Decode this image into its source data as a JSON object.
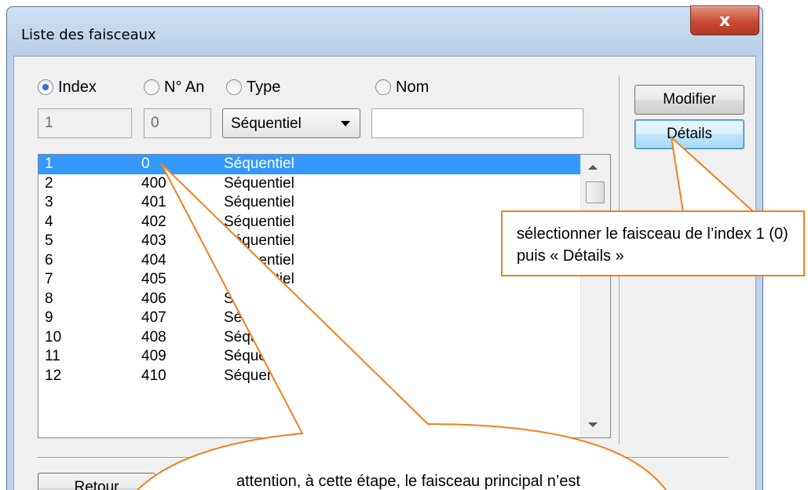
{
  "window": {
    "title": "Liste des faisceaux",
    "close_label": "x"
  },
  "search": {
    "radios": [
      {
        "label": "Index",
        "selected": true
      },
      {
        "label": "N° An",
        "selected": false
      },
      {
        "label": "Type",
        "selected": false
      },
      {
        "label": "Nom",
        "selected": false
      }
    ],
    "index_value": "1",
    "nan_value": "0",
    "type_value": "Séquentiel",
    "name_value": ""
  },
  "list": {
    "rows": [
      {
        "index": "1",
        "nan": "0",
        "type": "Séquentiel",
        "selected": true
      },
      {
        "index": "2",
        "nan": "400",
        "type": "Séquentiel"
      },
      {
        "index": "3",
        "nan": "401",
        "type": "Séquentiel"
      },
      {
        "index": "4",
        "nan": "402",
        "type": "Séquentiel"
      },
      {
        "index": "5",
        "nan": "403",
        "type": "Séquentiel"
      },
      {
        "index": "6",
        "nan": "404",
        "type": "Séquentiel"
      },
      {
        "index": "7",
        "nan": "405",
        "type": "Séquentiel"
      },
      {
        "index": "8",
        "nan": "406",
        "type": "Séquentiel"
      },
      {
        "index": "9",
        "nan": "407",
        "type": "Séquentiel"
      },
      {
        "index": "10",
        "nan": "408",
        "type": "Séquentiel"
      },
      {
        "index": "11",
        "nan": "409",
        "type": "Séquentiel"
      },
      {
        "index": "12",
        "nan": "410",
        "type": "Séquentiel"
      }
    ]
  },
  "buttons": {
    "modifier": "Modifier",
    "details": "Détails",
    "retour": "Retour"
  },
  "annotations": {
    "callout_details": "sélectionner le faisceau de l’index 1 (0) puis « Détails »",
    "callout_bottom": "attention, à cette étape, le faisceau principal n’est"
  },
  "colors": {
    "selection": "#3399ff",
    "callout_border": "#f07f1e",
    "close_button": "#c84b34"
  }
}
